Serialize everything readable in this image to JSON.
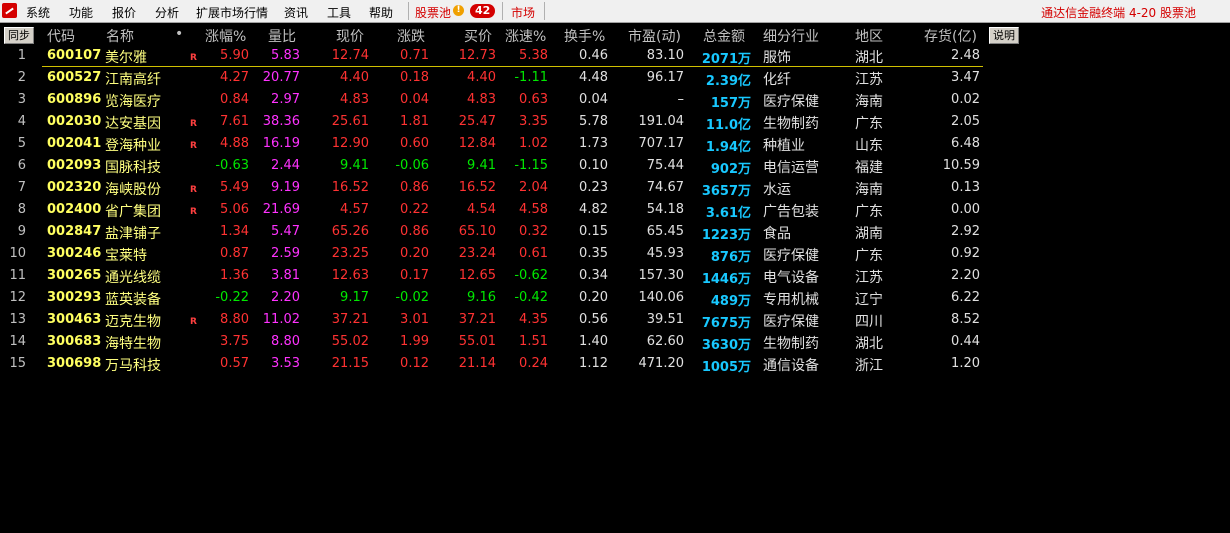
{
  "menu": {
    "items": [
      "系统",
      "功能",
      "报价",
      "分析",
      "扩展市场行情",
      "资讯",
      "工具",
      "帮助"
    ],
    "pool_label": "股票池",
    "pool_count": "42",
    "market_label": "市场",
    "right_title": "通达信金融终端  4-20 股票池"
  },
  "header": {
    "sync_btn": "同步",
    "explain_btn": "说明",
    "cols": [
      "代码",
      "名称",
      "•",
      "涨幅%",
      "量比",
      "现价",
      "涨跌",
      "买价",
      "涨速%",
      "换手%",
      "市盈(动)",
      "总金额",
      "细分行业",
      "地区",
      "存货(亿)"
    ]
  },
  "colors": {
    "up": "#ff3232",
    "down": "#00e800",
    "volratio": "#ff32ff",
    "amount": "#18c8ff"
  },
  "rows": [
    {
      "n": "1",
      "code": "600107",
      "name": "美尔雅",
      "flag": "R",
      "chg": "5.90",
      "vr": "5.83",
      "price": "12.74",
      "diff": "0.71",
      "bid": "12.73",
      "spd": "5.38",
      "turn": "0.46",
      "pe": "83.10",
      "amt": "2071万",
      "ind": "服饰",
      "reg": "湖北",
      "inv": "2.48",
      "dir": "up",
      "spd_dir": "up"
    },
    {
      "n": "2",
      "code": "600527",
      "name": "江南高纤",
      "flag": "",
      "chg": "4.27",
      "vr": "20.77",
      "price": "4.40",
      "diff": "0.18",
      "bid": "4.40",
      "spd": "-1.11",
      "turn": "4.48",
      "pe": "96.17",
      "amt": "2.39亿",
      "ind": "化纤",
      "reg": "江苏",
      "inv": "3.47",
      "dir": "up",
      "spd_dir": "down"
    },
    {
      "n": "3",
      "code": "600896",
      "name": "览海医疗",
      "flag": "",
      "chg": "0.84",
      "vr": "2.97",
      "price": "4.83",
      "diff": "0.04",
      "bid": "4.83",
      "spd": "0.63",
      "turn": "0.04",
      "pe": "–",
      "amt": "157万",
      "ind": "医疗保健",
      "reg": "海南",
      "inv": "0.02",
      "dir": "up",
      "spd_dir": "up"
    },
    {
      "n": "4",
      "code": "002030",
      "name": "达安基因",
      "flag": "R",
      "chg": "7.61",
      "vr": "38.36",
      "price": "25.61",
      "diff": "1.81",
      "bid": "25.47",
      "spd": "3.35",
      "turn": "5.78",
      "pe": "191.04",
      "amt": "11.0亿",
      "ind": "生物制药",
      "reg": "广东",
      "inv": "2.05",
      "dir": "up",
      "spd_dir": "up"
    },
    {
      "n": "5",
      "code": "002041",
      "name": "登海种业",
      "flag": "R",
      "chg": "4.88",
      "vr": "16.19",
      "price": "12.90",
      "diff": "0.60",
      "bid": "12.84",
      "spd": "1.02",
      "turn": "1.73",
      "pe": "707.17",
      "amt": "1.94亿",
      "ind": "种植业",
      "reg": "山东",
      "inv": "6.48",
      "dir": "up",
      "spd_dir": "up"
    },
    {
      "n": "6",
      "code": "002093",
      "name": "国脉科技",
      "flag": "",
      "chg": "-0.63",
      "vr": "2.44",
      "price": "9.41",
      "diff": "-0.06",
      "bid": "9.41",
      "spd": "-1.15",
      "turn": "0.10",
      "pe": "75.44",
      "amt": "902万",
      "ind": "电信运营",
      "reg": "福建",
      "inv": "10.59",
      "dir": "down",
      "spd_dir": "down"
    },
    {
      "n": "7",
      "code": "002320",
      "name": "海峡股份",
      "flag": "R",
      "chg": "5.49",
      "vr": "9.19",
      "price": "16.52",
      "diff": "0.86",
      "bid": "16.52",
      "spd": "2.04",
      "turn": "0.23",
      "pe": "74.67",
      "amt": "3657万",
      "ind": "水运",
      "reg": "海南",
      "inv": "0.13",
      "dir": "up",
      "spd_dir": "up"
    },
    {
      "n": "8",
      "code": "002400",
      "name": "省广集团",
      "flag": "R",
      "chg": "5.06",
      "vr": "21.69",
      "price": "4.57",
      "diff": "0.22",
      "bid": "4.54",
      "spd": "4.58",
      "turn": "4.82",
      "pe": "54.18",
      "amt": "3.61亿",
      "ind": "广告包装",
      "reg": "广东",
      "inv": "0.00",
      "dir": "up",
      "spd_dir": "up"
    },
    {
      "n": "9",
      "code": "002847",
      "name": "盐津铺子",
      "flag": "",
      "chg": "1.34",
      "vr": "5.47",
      "price": "65.26",
      "diff": "0.86",
      "bid": "65.10",
      "spd": "0.32",
      "turn": "0.15",
      "pe": "65.45",
      "amt": "1223万",
      "ind": "食品",
      "reg": "湖南",
      "inv": "2.92",
      "dir": "up",
      "spd_dir": "up"
    },
    {
      "n": "10",
      "code": "300246",
      "name": "宝莱特",
      "flag": "",
      "chg": "0.87",
      "vr": "2.59",
      "price": "23.25",
      "diff": "0.20",
      "bid": "23.24",
      "spd": "0.61",
      "turn": "0.35",
      "pe": "45.93",
      "amt": "876万",
      "ind": "医疗保健",
      "reg": "广东",
      "inv": "0.92",
      "dir": "up",
      "spd_dir": "up"
    },
    {
      "n": "11",
      "code": "300265",
      "name": "通光线缆",
      "flag": "",
      "chg": "1.36",
      "vr": "3.81",
      "price": "12.63",
      "diff": "0.17",
      "bid": "12.65",
      "spd": "-0.62",
      "turn": "0.34",
      "pe": "157.30",
      "amt": "1446万",
      "ind": "电气设备",
      "reg": "江苏",
      "inv": "2.20",
      "dir": "up",
      "spd_dir": "down"
    },
    {
      "n": "12",
      "code": "300293",
      "name": "蓝英装备",
      "flag": "",
      "chg": "-0.22",
      "vr": "2.20",
      "price": "9.17",
      "diff": "-0.02",
      "bid": "9.16",
      "spd": "-0.42",
      "turn": "0.20",
      "pe": "140.06",
      "amt": "489万",
      "ind": "专用机械",
      "reg": "辽宁",
      "inv": "6.22",
      "dir": "down",
      "spd_dir": "down"
    },
    {
      "n": "13",
      "code": "300463",
      "name": "迈克生物",
      "flag": "R",
      "chg": "8.80",
      "vr": "11.02",
      "price": "37.21",
      "diff": "3.01",
      "bid": "37.21",
      "spd": "4.35",
      "turn": "0.56",
      "pe": "39.51",
      "amt": "7675万",
      "ind": "医疗保健",
      "reg": "四川",
      "inv": "8.52",
      "dir": "up",
      "spd_dir": "up"
    },
    {
      "n": "14",
      "code": "300683",
      "name": "海特生物",
      "flag": "",
      "chg": "3.75",
      "vr": "8.80",
      "price": "55.02",
      "diff": "1.99",
      "bid": "55.01",
      "spd": "1.51",
      "turn": "1.40",
      "pe": "62.60",
      "amt": "3630万",
      "ind": "生物制药",
      "reg": "湖北",
      "inv": "0.44",
      "dir": "up",
      "spd_dir": "up"
    },
    {
      "n": "15",
      "code": "300698",
      "name": "万马科技",
      "flag": "",
      "chg": "0.57",
      "vr": "3.53",
      "price": "21.15",
      "diff": "0.12",
      "bid": "21.14",
      "spd": "0.24",
      "turn": "1.12",
      "pe": "471.20",
      "amt": "1005万",
      "ind": "通信设备",
      "reg": "浙江",
      "inv": "1.20",
      "dir": "up",
      "spd_dir": "up"
    }
  ]
}
